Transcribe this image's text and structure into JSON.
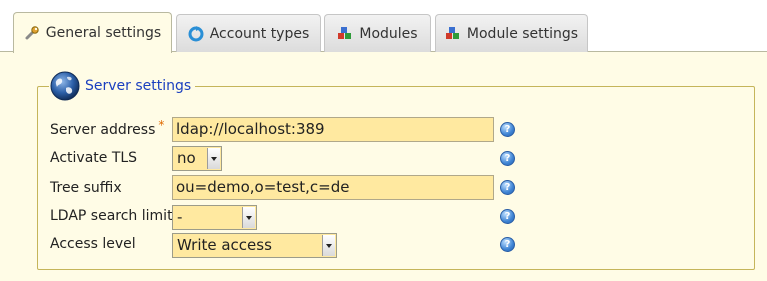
{
  "tabs": [
    {
      "label": "General settings",
      "icon": "wrench-icon",
      "active": true
    },
    {
      "label": "Account types",
      "icon": "sync-icon",
      "active": false
    },
    {
      "label": "Modules",
      "icon": "modules-icon",
      "active": false
    },
    {
      "label": "Module settings",
      "icon": "modules-icon",
      "active": false
    }
  ],
  "server_settings": {
    "legend": "Server settings",
    "server_address": {
      "label": "Server address",
      "required_marker": "*",
      "value": "ldap://localhost:389"
    },
    "activate_tls": {
      "label": "Activate TLS",
      "value": "no"
    },
    "tree_suffix": {
      "label": "Tree suffix",
      "value": "ou=demo,o=test,c=de"
    },
    "ldap_search_limit": {
      "label": "LDAP search limit",
      "value": "-"
    },
    "access_level": {
      "label": "Access level",
      "value": "Write access"
    },
    "help_glyph": "?"
  },
  "colors": {
    "accent": "#1a3fbf",
    "input_bg": "#ffe9a0",
    "panel_bg": "#fffce6",
    "fieldset_border": "#c5b55a"
  }
}
